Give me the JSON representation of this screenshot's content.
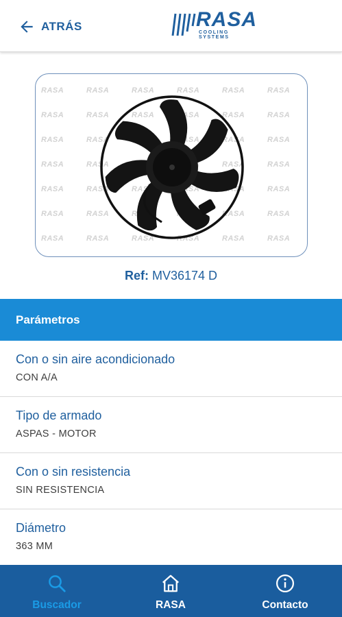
{
  "header": {
    "back_label": "ATRÁS",
    "logo_text": "RASA",
    "logo_subtitle": "COOLING SYSTEMS"
  },
  "product": {
    "watermark_text": "RASA",
    "ref_label": "Ref:",
    "ref_value": "MV36174 D"
  },
  "section": {
    "title": "Parámetros"
  },
  "parameters": [
    {
      "title": "Con o sin aire acondicionado",
      "value": "CON A/A"
    },
    {
      "title": "Tipo de armado",
      "value": "ASPAS - MOTOR"
    },
    {
      "title": "Con o sin resistencia",
      "value": "SIN RESISTENCIA"
    },
    {
      "title": "Diámetro",
      "value": "363 MM"
    }
  ],
  "nav": {
    "items": [
      {
        "label": "Buscador",
        "icon": "search-icon",
        "active": true
      },
      {
        "label": "RASA",
        "icon": "home-icon",
        "active": false
      },
      {
        "label": "Contacto",
        "icon": "info-icon",
        "active": false
      }
    ]
  },
  "colors": {
    "brand": "#1f5f9e",
    "section_header": "#1a8bd6",
    "nav_background": "#1a5d9e",
    "nav_active": "#1a9be6"
  }
}
